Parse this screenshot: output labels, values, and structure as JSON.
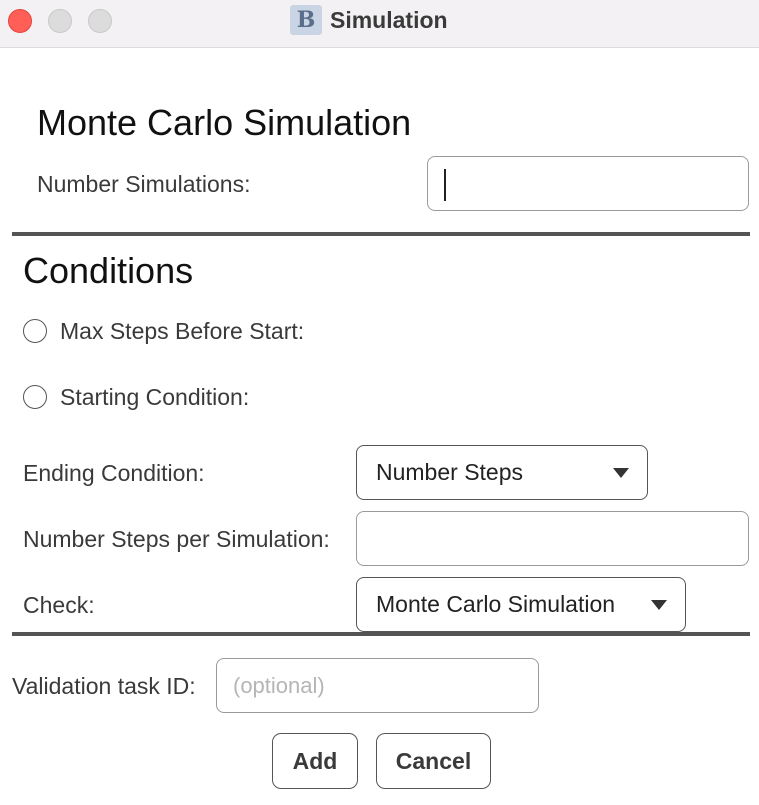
{
  "window": {
    "title": "Simulation",
    "app_icon": "B",
    "controls": {
      "close_icon": "close-icon",
      "minimize_icon": "minimize-icon",
      "zoom_icon": "zoom-icon"
    }
  },
  "monte_carlo": {
    "heading": "Monte Carlo Simulation",
    "number_simulations_label": "Number Simulations:",
    "number_simulations_value": ""
  },
  "conditions": {
    "heading": "Conditions",
    "max_steps_label": "Max Steps Before Start:",
    "max_steps_checked": false,
    "starting_condition_label": "Starting Condition:",
    "starting_condition_checked": false,
    "ending_condition_label": "Ending Condition:",
    "ending_condition_value": "Number Steps",
    "steps_per_sim_label": "Number Steps per Simulation:",
    "steps_per_sim_value": "",
    "check_label": "Check:",
    "check_value": "Monte Carlo Simulation"
  },
  "validation": {
    "label": "Validation task ID:",
    "placeholder": "(optional)",
    "value": ""
  },
  "actions": {
    "add_label": "Add",
    "cancel_label": "Cancel"
  }
}
